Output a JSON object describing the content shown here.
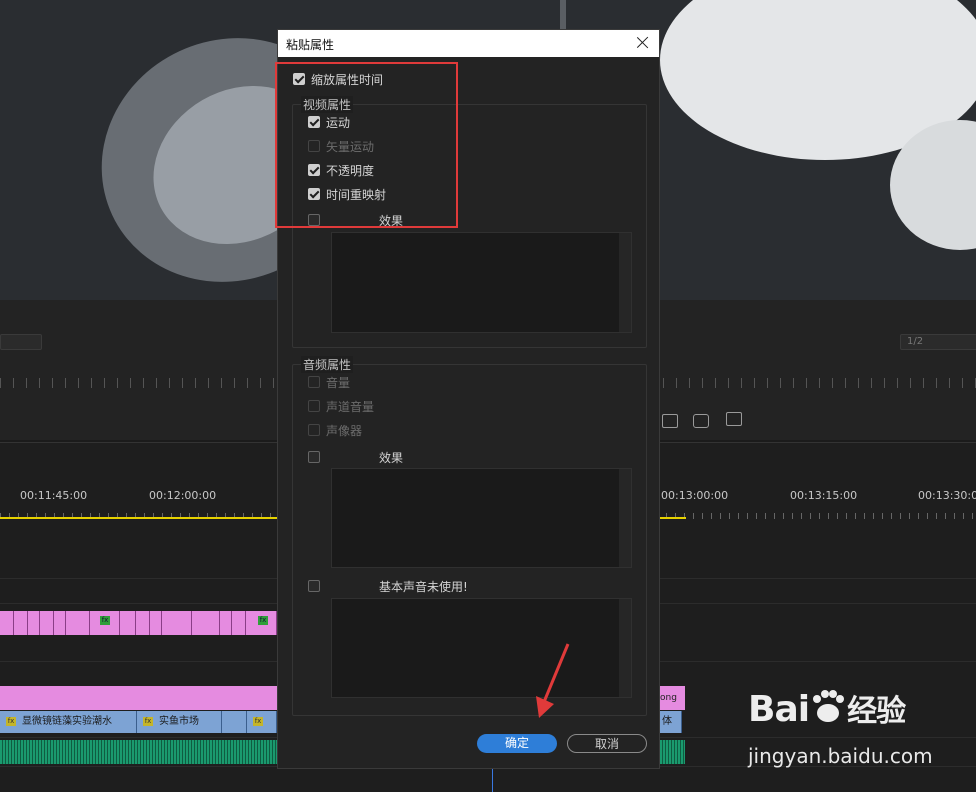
{
  "dialog": {
    "title": "粘贴属性",
    "scale_attr_time": {
      "label": "缩放属性时间",
      "checked": true
    },
    "video_group": {
      "title": "视频属性",
      "items": [
        {
          "label": "运动",
          "checked": true,
          "disabled": false
        },
        {
          "label": "矢量运动",
          "checked": false,
          "disabled": true
        },
        {
          "label": "不透明度",
          "checked": true,
          "disabled": false
        },
        {
          "label": "时间重映射",
          "checked": true,
          "disabled": false
        }
      ],
      "effects_label": "效果"
    },
    "audio_group": {
      "title": "音频属性",
      "items": [
        {
          "label": "音量",
          "checked": false,
          "disabled": true
        },
        {
          "label": "声道音量",
          "checked": false,
          "disabled": true
        },
        {
          "label": "声像器",
          "checked": false,
          "disabled": true
        }
      ],
      "effects_label": "效果",
      "essential_sound_label": "基本声音未使用!"
    },
    "ok_label": "确定",
    "cancel_label": "取消"
  },
  "monitor": {
    "resolution": "1/2"
  },
  "timeline": {
    "timecodes": [
      "00:11:45:00",
      "00:12:00:00",
      "00:13:00:00",
      "00:13:15:00",
      "00:13:30:00"
    ],
    "clips": [
      {
        "label": "显微镜链藻实验潮水"
      },
      {
        "label": "实鱼市场"
      }
    ],
    "partial_clip_labels": [
      "ong",
      "体"
    ]
  },
  "watermark": {
    "logo": "Bai",
    "logo_tail": "经验",
    "url": "jingyan.baidu.com"
  },
  "colors": {
    "accent": "#2e7ed8",
    "annotation": "#e03a3a",
    "video_clip": "#e58be0",
    "audio_clip": "#1a9a6e"
  }
}
